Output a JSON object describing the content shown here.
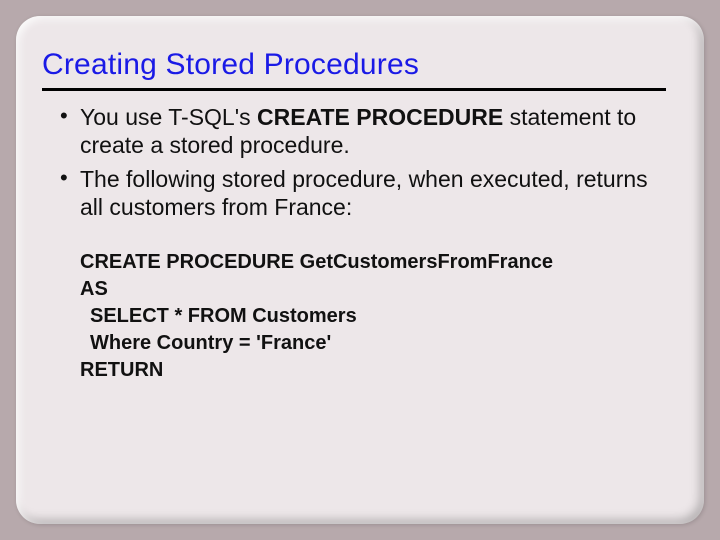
{
  "title": "Creating Stored Procedures",
  "bullets": [
    {
      "pre": "You use T-SQL's ",
      "strong": "CREATE PROCEDURE",
      "post": " statement to create a stored procedure."
    },
    {
      "pre": "The following stored procedure, when executed, returns all customers from France:",
      "strong": "",
      "post": ""
    }
  ],
  "code": {
    "l1": "CREATE PROCEDURE GetCustomersFromFrance",
    "l2": "AS",
    "l3": "SELECT * FROM Customers",
    "l4": "Where Country = 'France'",
    "l5": "RETURN"
  }
}
